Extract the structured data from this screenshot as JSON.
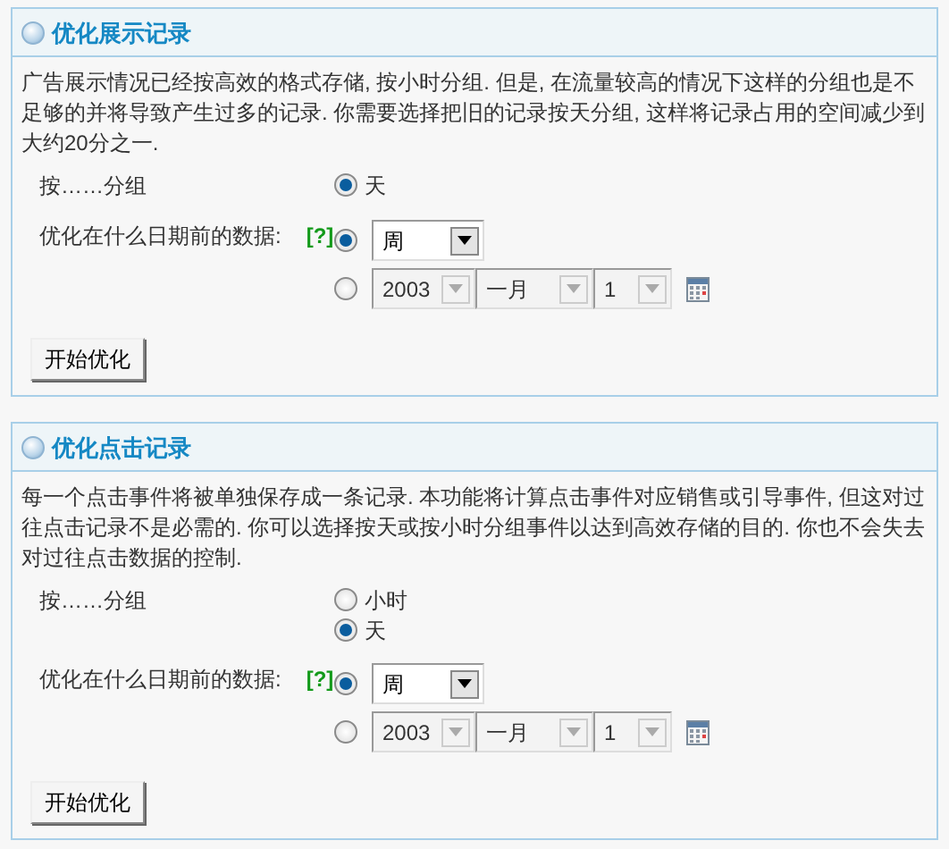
{
  "panels": [
    {
      "title": "优化展示记录",
      "description": "广告展示情况已经按高效的格式存储, 按小时分组. 但是, 在流量较高的情况下这样的分组也是不足够的并将导致产生过多的记录. 你需要选择把旧的记录按天分组, 这样将记录占用的空间减少到大约20分之一.",
      "group_by": {
        "label": "按……分组",
        "options": [
          {
            "label": "天",
            "selected": true
          }
        ]
      },
      "date": {
        "label": "优化在什么日期前的数据:",
        "help": "[?]",
        "options": [
          {
            "kind": "period",
            "selected": true,
            "value": "周"
          },
          {
            "kind": "date",
            "selected": false,
            "year": "2003",
            "month": "一月",
            "day": "1",
            "disabled": true
          }
        ]
      },
      "button": "开始优化"
    },
    {
      "title": "优化点击记录",
      "description": "每一个点击事件将被单独保存成一条记录. 本功能将计算点击事件对应销售或引导事件, 但这对过往点击记录不是必需的. 你可以选择按天或按小时分组事件以达到高效存储的目的. 你也不会失去对过往点击数据的控制.",
      "group_by": {
        "label": "按……分组",
        "options": [
          {
            "label": "小时",
            "selected": false
          },
          {
            "label": "天",
            "selected": true
          }
        ]
      },
      "date": {
        "label": "优化在什么日期前的数据:",
        "help": "[?]",
        "options": [
          {
            "kind": "period",
            "selected": true,
            "value": "周"
          },
          {
            "kind": "date",
            "selected": false,
            "year": "2003",
            "month": "一月",
            "day": "1",
            "disabled": true
          }
        ]
      },
      "button": "开始优化"
    }
  ]
}
